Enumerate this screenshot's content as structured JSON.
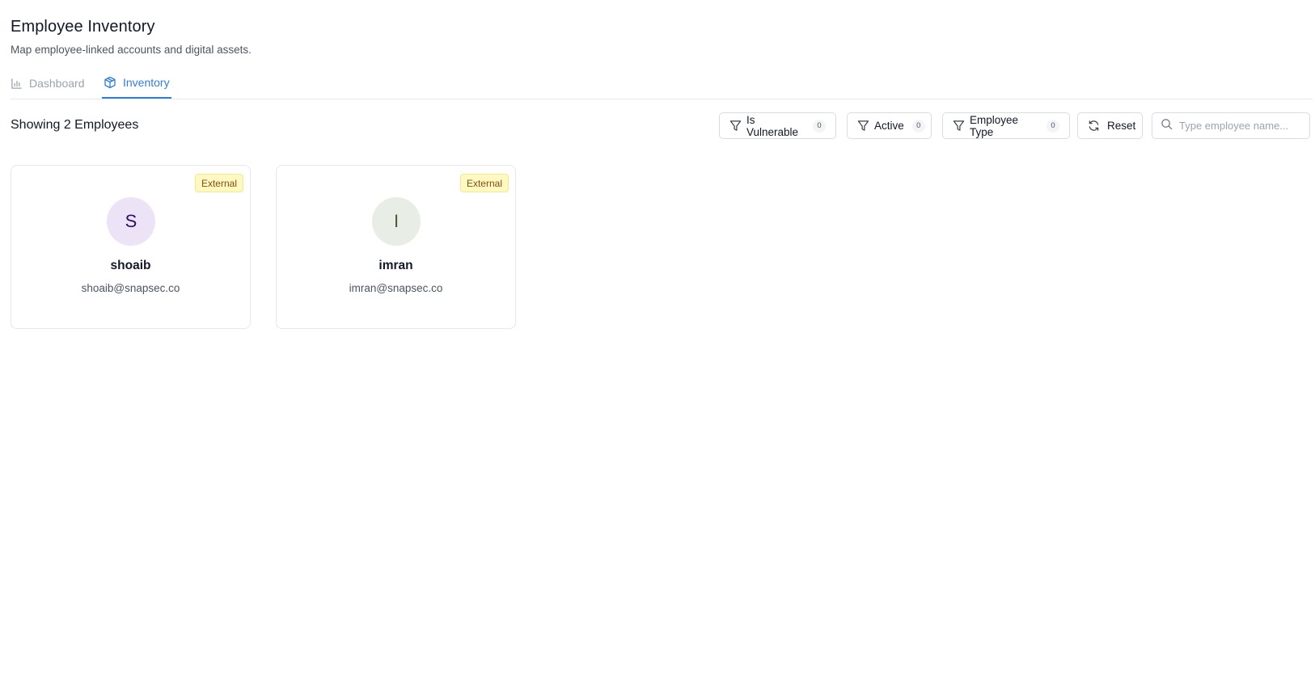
{
  "header": {
    "title": "Employee Inventory",
    "subtitle": "Map employee-linked accounts and digital assets."
  },
  "tabs": [
    {
      "label": "Dashboard",
      "icon": "bar-chart-icon",
      "active": false
    },
    {
      "label": "Inventory",
      "icon": "box-icon",
      "active": true
    }
  ],
  "toolbar": {
    "showing_text": "Showing 2 Employees",
    "filters": [
      {
        "label": "Is Vulnerable",
        "count": "0",
        "icon": "filter-icon"
      },
      {
        "label": "Active",
        "count": "0",
        "icon": "filter-icon"
      },
      {
        "label": "Employee Type",
        "count": "0",
        "icon": "filter-icon"
      }
    ],
    "reset_label": "Reset",
    "search": {
      "placeholder": "Type employee name...",
      "value": ""
    }
  },
  "employees": [
    {
      "initial": "S",
      "name": "shoaib",
      "email": "shoaib@snapsec.co",
      "type": "External",
      "avatar_bg": "#ede3f7"
    },
    {
      "initial": "I",
      "name": "imran",
      "email": "imran@snapsec.co",
      "type": "External",
      "avatar_bg": "#e8ede5"
    }
  ],
  "colors": {
    "accent": "#2f7de1",
    "tag_bg": "#fef9c3",
    "tag_text": "#854d0e"
  }
}
